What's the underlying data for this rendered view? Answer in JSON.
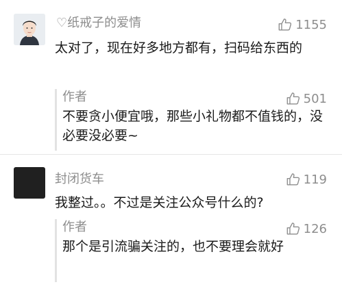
{
  "comments": [
    {
      "username": "♡纸戒子的爱情",
      "likes": "1155",
      "text": "太对了，现在好多地方都有，扫码给东西的",
      "reply": {
        "author": "作者",
        "likes": "501",
        "text": "不要贪小便宜哦，那些小礼物都不值钱的，没必要没必要~"
      }
    },
    {
      "username": "封闭货车",
      "likes": "119",
      "text": "我整过。。不过是关注公众号什么的?",
      "reply": {
        "author": "作者",
        "likes": "126",
        "text": "那个是引流骗关注的，也不要理会就好"
      }
    }
  ],
  "colors": {
    "meta_text": "#8d8d8d",
    "body_text": "#1a1a1a",
    "reply_bar": "#e2e2e2",
    "divider": "#e6e6e6"
  },
  "icons": {
    "like": "thumbs-up-icon"
  }
}
